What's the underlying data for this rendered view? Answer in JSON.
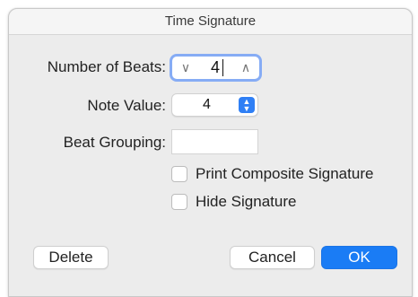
{
  "dialog": {
    "title": "Time Signature"
  },
  "fields": {
    "number_of_beats": {
      "label": "Number of Beats:",
      "value": "4",
      "decrement_glyph": "∨",
      "increment_glyph": "∧"
    },
    "note_value": {
      "label": "Note Value:",
      "value": "4"
    },
    "beat_grouping": {
      "label": "Beat Grouping:",
      "value": ""
    }
  },
  "options": {
    "print_composite_signature": {
      "label": "Print Composite Signature",
      "checked": false
    },
    "hide_signature": {
      "label": "Hide Signature",
      "checked": false
    }
  },
  "buttons": {
    "delete": "Delete",
    "cancel": "Cancel",
    "ok": "OK"
  },
  "colors": {
    "accent": "#1a7cf5",
    "focus_ring": "#86acf5"
  }
}
